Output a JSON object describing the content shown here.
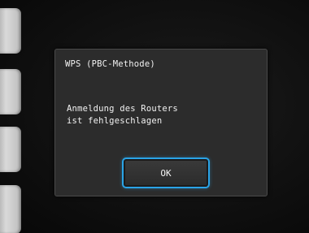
{
  "dialog": {
    "title": "WPS (PBC-Methode)",
    "message_line1": "Anmeldung des Routers",
    "message_line2": "ist fehlgeschlagen",
    "ok_label": "OK"
  },
  "colors": {
    "dialog_bg": "#2c2c2c",
    "button_focus_border": "#2aa3e6",
    "text": "#f2f2f2"
  }
}
